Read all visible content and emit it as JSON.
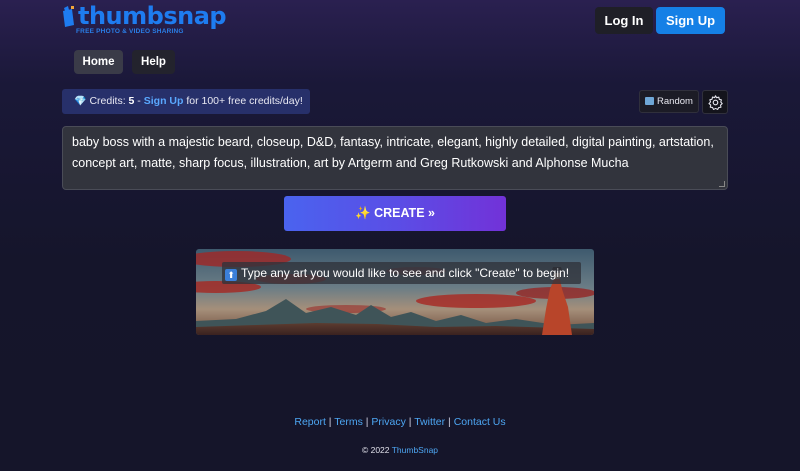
{
  "header": {
    "logo_text": "thumbsnap",
    "logo_tagline": "FREE PHOTO & VIDEO SHARING",
    "login_label": "Log In",
    "signup_label": "Sign Up"
  },
  "nav": {
    "home_label": "Home",
    "help_label": "Help"
  },
  "credits": {
    "gem_icon": "gem-icon",
    "prefix": "Credits: ",
    "count": "5",
    "separator": " - ",
    "link": "Sign Up",
    "suffix": " for 100+ free credits/day!"
  },
  "toolbar": {
    "random_label": "Random",
    "settings_icon": "gear-icon"
  },
  "prompt": {
    "value": "baby boss with a majestic beard, closeup, D&D, fantasy, intricate, elegant, highly detailed, digital painting, artstation, concept art, matte, sharp focus, illustration, art by Artgerm and Greg Rutkowski and Alphonse Mucha"
  },
  "create": {
    "label": "✨ CREATE »"
  },
  "hero": {
    "arrow_icon": "up-arrow-icon",
    "caption": "Type any art you would like to see and click \"Create\" to begin!"
  },
  "footer": {
    "links": [
      "Report",
      "Terms",
      "Privacy",
      "Twitter",
      "Contact Us"
    ],
    "separator": " | ",
    "copyright": "© 2022 ",
    "brand": "ThumbSnap"
  },
  "colors": {
    "accent_blue": "#1580e6",
    "link_blue": "#4da6f2",
    "create_gradient_start": "#4a63ef",
    "create_gradient_end": "#7232d8"
  }
}
